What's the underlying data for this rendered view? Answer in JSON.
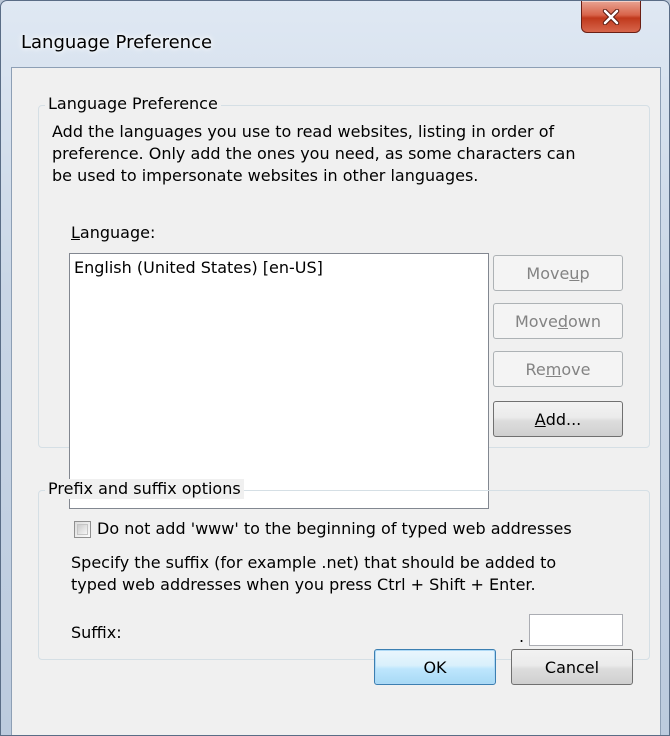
{
  "window": {
    "title": "Language Preference",
    "close_glyph": "X"
  },
  "language_group": {
    "legend": "Language Preference",
    "description_lines": [
      "Add the languages you use to read websites, listing in order of",
      "preference. Only add the ones you need, as some characters can",
      "be used to impersonate websites in other languages."
    ],
    "list_label": {
      "pre": "",
      "accel": "L",
      "post": "anguage:"
    },
    "languages": [
      "English (United States) [en-US]"
    ],
    "buttons": {
      "move_up": {
        "pre": "Move ",
        "accel": "u",
        "post": "p",
        "enabled": false
      },
      "move_down": {
        "pre": "Move ",
        "accel": "d",
        "post": "own",
        "enabled": false
      },
      "remove": {
        "pre": "Re",
        "accel": "m",
        "post": "ove",
        "enabled": false
      },
      "add": {
        "pre": "",
        "accel": "A",
        "post": "dd...",
        "enabled": true
      }
    }
  },
  "prefix_group": {
    "legend": "Prefix and suffix options",
    "checkbox_label": "Do not add 'www' to the beginning of typed web addresses",
    "checkbox_checked": false,
    "suffix_description_lines": [
      "Specify the suffix (for example .net) that should be added to",
      "typed web addresses when you press Ctrl + Shift + Enter."
    ],
    "suffix_label": "Suffix:",
    "suffix_dot": ".",
    "suffix_value": ""
  },
  "footer": {
    "ok_label": "OK",
    "cancel_label": "Cancel"
  }
}
